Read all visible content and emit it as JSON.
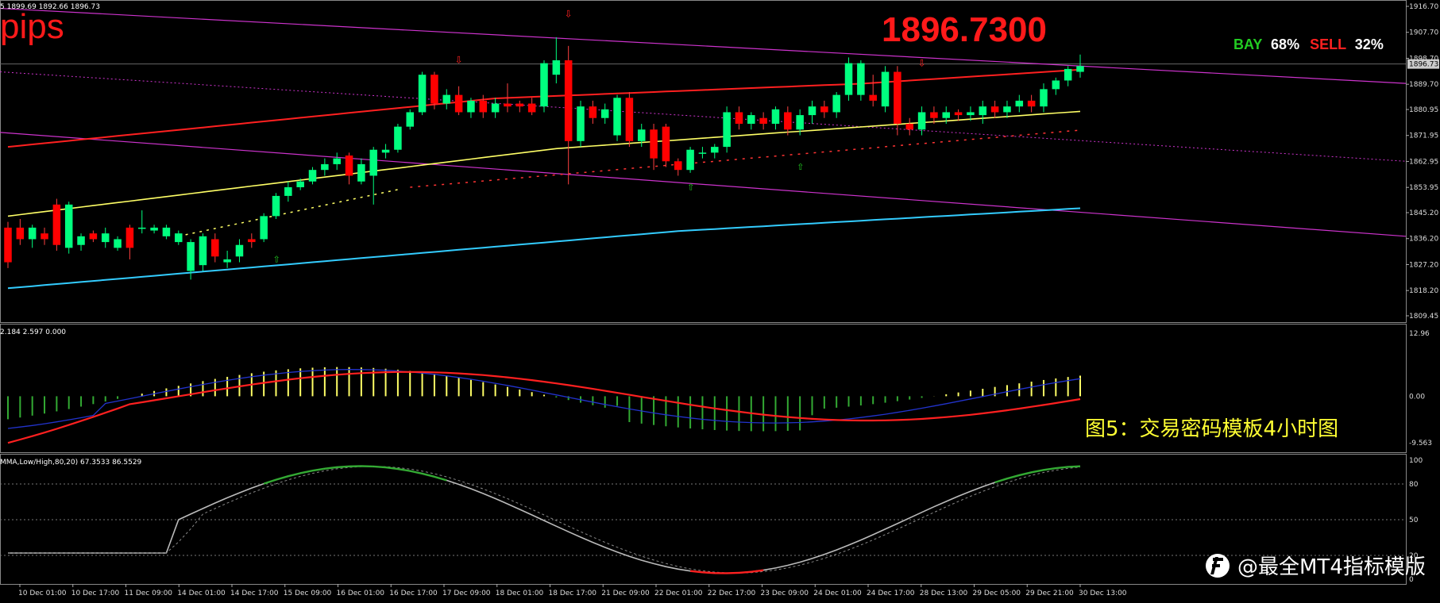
{
  "header": {
    "ohlc_text": "5 1899.69 1892.66 1896.73",
    "pips_label": "pips",
    "current_price": "1896.7300",
    "bay_label": "BAY",
    "bay_pct": "68%",
    "sell_label": "SELL",
    "sell_pct": "32%",
    "price_marker": "1896.73"
  },
  "price_axis": [
    "1916.70",
    "1907.70",
    "1898.70",
    "1889.70",
    "1880.95",
    "1871.95",
    "1862.95",
    "1853.95",
    "1845.20",
    "1836.20",
    "1827.20",
    "1818.20",
    "1809.45"
  ],
  "macd": {
    "header": "2.184 2.597 0.000",
    "axis": [
      "12.96",
      "0.00",
      "-9.563"
    ]
  },
  "stoch": {
    "header": "MMA,Low/High,80,20) 67.3533 86.5529",
    "axis": [
      "100",
      "80",
      "50",
      "20",
      "0"
    ]
  },
  "overlay": {
    "caption": "图5：交易密码模板4小时图",
    "watermark": "@最全MT4指标模版"
  },
  "time_axis": [
    "10 Dec 01:00",
    "10 Dec 17:00",
    "11 Dec 09:00",
    "14 Dec 01:00",
    "14 Dec 17:00",
    "15 Dec 09:00",
    "16 Dec 01:00",
    "16 Dec 17:00",
    "17 Dec 09:00",
    "18 Dec 01:00",
    "18 Dec 17:00",
    "21 Dec 09:00",
    "22 Dec 01:00",
    "22 Dec 17:00",
    "23 Dec 09:00",
    "24 Dec 01:00",
    "24 Dec 17:00",
    "28 Dec 13:00",
    "29 Dec 05:00",
    "29 Dec 21:00",
    "30 Dec 13:00"
  ],
  "colors": {
    "bull": "#00ff7f",
    "bear": "#ff0000",
    "ma_yellow": "#ffff66",
    "band_upper": "#ff2020",
    "band_lower": "#33ccff",
    "channel": "#cc33cc",
    "bay": "#22cc22",
    "sell": "#ff2020",
    "caption": "#ffff33"
  },
  "chart_data": {
    "type": "candlestick",
    "price_range": [
      1809.45,
      1916.7
    ],
    "candles": [
      [
        1840,
        1828,
        1842,
        1826
      ],
      [
        1840,
        1836,
        1843,
        1834
      ],
      [
        1836,
        1840,
        1841,
        1833
      ],
      [
        1838,
        1836,
        1840,
        1834
      ],
      [
        1848,
        1834,
        1850,
        1832
      ],
      [
        1833,
        1848,
        1849,
        1831
      ],
      [
        1834,
        1837,
        1838,
        1832
      ],
      [
        1838,
        1836,
        1839,
        1835
      ],
      [
        1835,
        1838,
        1840,
        1833
      ],
      [
        1833,
        1836,
        1837,
        1832
      ],
      [
        1840,
        1833,
        1841,
        1829
      ],
      [
        1840,
        1840,
        1846,
        1838
      ],
      [
        1839,
        1840,
        1841,
        1838
      ],
      [
        1837,
        1840,
        1841,
        1836
      ],
      [
        1835,
        1838,
        1839,
        1834
      ],
      [
        1825,
        1835,
        1836,
        1822
      ],
      [
        1827,
        1837,
        1838,
        1825
      ],
      [
        1836,
        1830,
        1838,
        1828
      ],
      [
        1828,
        1829,
        1832,
        1826
      ],
      [
        1830,
        1834,
        1836,
        1828
      ],
      [
        1836,
        1835,
        1838,
        1833
      ],
      [
        1836,
        1844,
        1845,
        1835
      ],
      [
        1844,
        1851,
        1852,
        1843
      ],
      [
        1851,
        1854,
        1856,
        1849
      ],
      [
        1854,
        1856,
        1857,
        1853
      ],
      [
        1856,
        1860,
        1861,
        1855
      ],
      [
        1860,
        1862,
        1864,
        1858
      ],
      [
        1862,
        1864,
        1866,
        1860
      ],
      [
        1865,
        1858,
        1866,
        1855
      ],
      [
        1856,
        1862,
        1864,
        1855
      ],
      [
        1858,
        1867,
        1868,
        1848
      ],
      [
        1866,
        1867,
        1869,
        1864
      ],
      [
        1867,
        1875,
        1876,
        1866
      ],
      [
        1875,
        1880,
        1881,
        1874
      ],
      [
        1880,
        1893,
        1894,
        1879
      ],
      [
        1893,
        1883,
        1894,
        1881
      ],
      [
        1883,
        1886,
        1888,
        1881
      ],
      [
        1886,
        1880,
        1889,
        1879
      ],
      [
        1880,
        1884,
        1885,
        1878
      ],
      [
        1884,
        1880,
        1886,
        1878
      ],
      [
        1880,
        1883,
        1885,
        1878
      ],
      [
        1883,
        1882,
        1890,
        1880
      ],
      [
        1883,
        1882,
        1884,
        1880
      ],
      [
        1883,
        1880,
        1885,
        1879
      ],
      [
        1882,
        1897,
        1898,
        1880
      ],
      [
        1893,
        1898,
        1906,
        1890
      ],
      [
        1898,
        1870,
        1903,
        1855
      ],
      [
        1870,
        1882,
        1884,
        1868
      ],
      [
        1882,
        1878,
        1884,
        1876
      ],
      [
        1878,
        1881,
        1883,
        1876
      ],
      [
        1872,
        1885,
        1886,
        1870
      ],
      [
        1885,
        1870,
        1887,
        1868
      ],
      [
        1870,
        1874,
        1876,
        1868
      ],
      [
        1874,
        1864,
        1876,
        1860
      ],
      [
        1875,
        1863,
        1876,
        1861
      ],
      [
        1863,
        1860,
        1864,
        1858
      ],
      [
        1860,
        1867,
        1868,
        1859
      ],
      [
        1866,
        1866,
        1868,
        1864
      ],
      [
        1866,
        1868,
        1869,
        1864
      ],
      [
        1868,
        1880,
        1882,
        1866
      ],
      [
        1880,
        1876,
        1882,
        1874
      ],
      [
        1876,
        1879,
        1880,
        1874
      ],
      [
        1878,
        1876,
        1880,
        1874
      ],
      [
        1876,
        1881,
        1882,
        1874
      ],
      [
        1880,
        1874,
        1882,
        1872
      ],
      [
        1874,
        1879,
        1881,
        1872
      ],
      [
        1879,
        1882,
        1884,
        1876
      ],
      [
        1882,
        1880,
        1884,
        1878
      ],
      [
        1880,
        1886,
        1887,
        1878
      ],
      [
        1886,
        1897,
        1899,
        1884
      ],
      [
        1886,
        1897,
        1898,
        1884
      ],
      [
        1886,
        1884,
        1893,
        1882
      ],
      [
        1882,
        1894,
        1896,
        1880
      ],
      [
        1894,
        1876,
        1896,
        1872
      ],
      [
        1876,
        1874,
        1878,
        1872
      ],
      [
        1874,
        1880,
        1882,
        1872
      ],
      [
        1880,
        1878,
        1882,
        1876
      ],
      [
        1878,
        1880,
        1882,
        1876
      ],
      [
        1880,
        1879,
        1881,
        1877
      ],
      [
        1879,
        1880,
        1882,
        1877
      ],
      [
        1879,
        1882,
        1884,
        1876
      ],
      [
        1882,
        1880,
        1884,
        1878
      ],
      [
        1880,
        1882,
        1884,
        1878
      ],
      [
        1882,
        1884,
        1886,
        1880
      ],
      [
        1884,
        1882,
        1886,
        1880
      ],
      [
        1882,
        1888,
        1890,
        1880
      ],
      [
        1888,
        1891,
        1892,
        1886
      ],
      [
        1891,
        1895,
        1896,
        1889
      ],
      [
        1894,
        1896,
        1900,
        1892
      ]
    ],
    "channel_lines": [
      {
        "from": [
          0,
          1916
        ],
        "to": [
          1,
          1890
        ]
      },
      {
        "from": [
          0,
          1872
        ],
        "to": [
          1,
          1838
        ]
      }
    ],
    "macd_range": [
      -9.563,
      12.96
    ],
    "stoch_range": [
      0,
      100
    ]
  }
}
